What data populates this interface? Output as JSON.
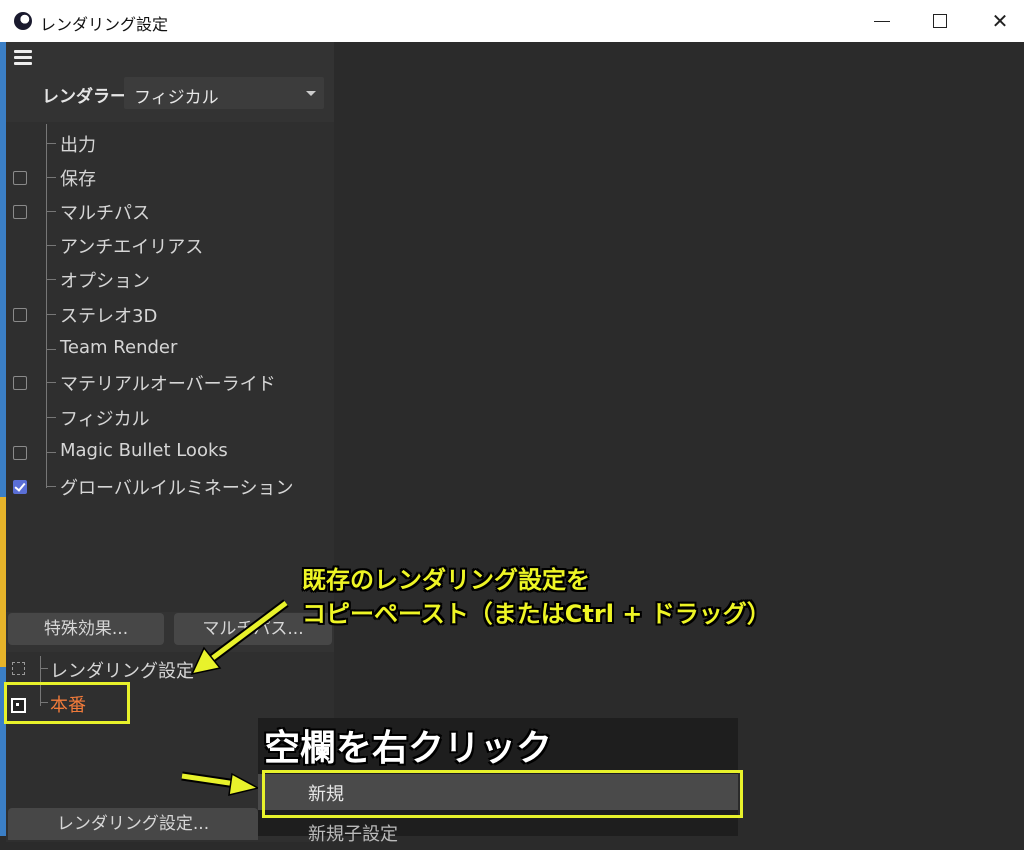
{
  "window": {
    "title": "レンダリング設定"
  },
  "toolbar": {
    "renderer_label": "レンダラー",
    "renderer_value": "フィジカル"
  },
  "tree": {
    "items": [
      {
        "label": "出力",
        "checkbox": "none"
      },
      {
        "label": "保存",
        "checkbox": "unchecked"
      },
      {
        "label": "マルチパス",
        "checkbox": "unchecked"
      },
      {
        "label": "アンチエイリアス",
        "checkbox": "none"
      },
      {
        "label": "オプション",
        "checkbox": "none"
      },
      {
        "label": "ステレオ3D",
        "checkbox": "unchecked"
      },
      {
        "label": "Team Render",
        "checkbox": "none"
      },
      {
        "label": "マテリアルオーバーライド",
        "checkbox": "unchecked"
      },
      {
        "label": "フィジカル",
        "checkbox": "none"
      },
      {
        "label": "Magic Bullet Looks",
        "checkbox": "unchecked"
      },
      {
        "label": "グローバルイルミネーション",
        "checkbox": "checked"
      }
    ]
  },
  "buttons": {
    "effects": "特殊効果...",
    "multipass": "マルチパス...",
    "render_settings": "レンダリング設定..."
  },
  "settings_list": {
    "items": [
      {
        "label": "レンダリング設定",
        "active": false,
        "color": "#d6d6d6"
      },
      {
        "label": "本番",
        "active": true,
        "color": "#f07a3a"
      }
    ]
  },
  "annotations": {
    "copy_line1": "既存のレンダリング設定を",
    "copy_line2": "コピーペースト（またはCtrl + ドラッグ）",
    "right_click": "空欄を右クリック",
    "highlight_color": "#e8f22b"
  },
  "context_menu": {
    "items": [
      "新規",
      "新規子設定"
    ]
  }
}
